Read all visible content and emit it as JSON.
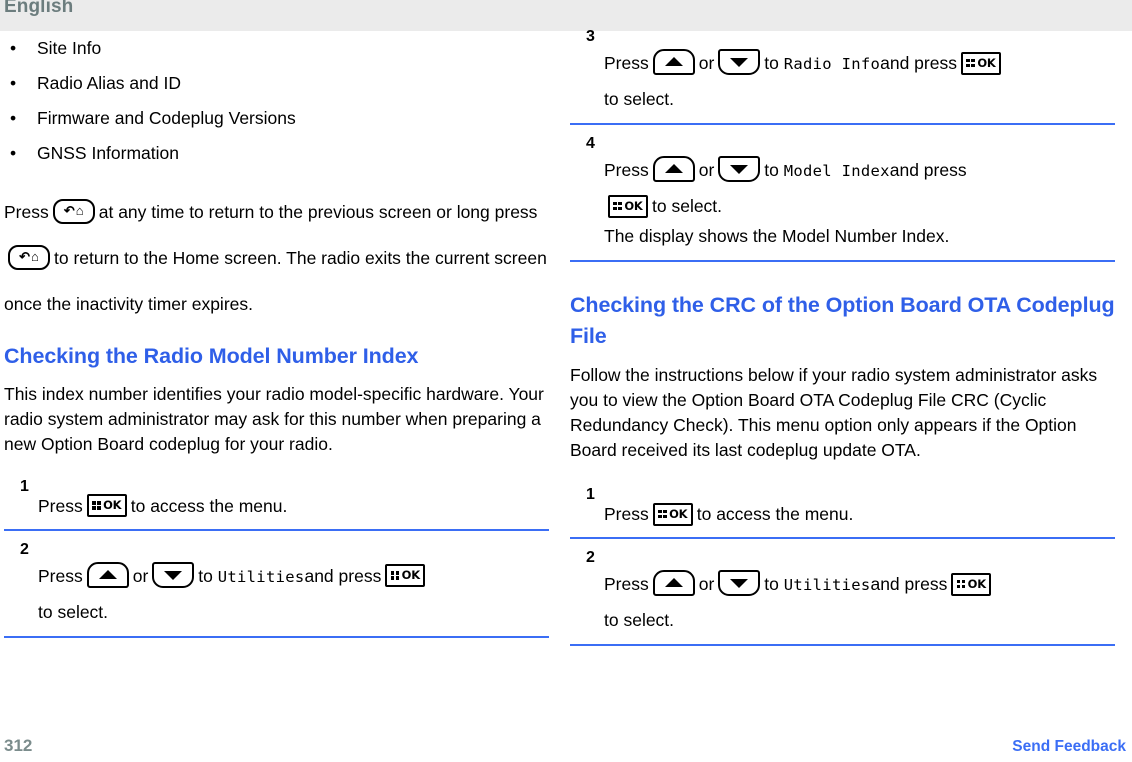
{
  "header": {
    "language": "English"
  },
  "footer": {
    "page_number": "312",
    "feedback_link": "Send Feedback"
  },
  "icons": {
    "ok_label": "OK",
    "ok_name": "ok-menu-key-icon",
    "up_name": "up-arrow-key-icon",
    "down_name": "down-arrow-key-icon",
    "back_name": "back-home-key-icon",
    "back_glyph_return": "↶",
    "back_glyph_home": "⌂"
  },
  "left_column": {
    "bullets": [
      {
        "marker": "•",
        "label": "Site Info"
      },
      {
        "marker": "•",
        "label": "Radio Alias and ID"
      },
      {
        "marker": "•",
        "label": "Firmware and Codeplug Versions"
      },
      {
        "marker": "•",
        "label": "GNSS Information"
      }
    ],
    "intro_paragraph": {
      "part1": "Press",
      "part2": "at any time to return to the previous screen or long press",
      "part3": "to return to the Home screen. The radio exits the current screen once the inactivity timer expires."
    },
    "heading": "Checking the Radio Model Number Index",
    "paragraph": "This index number identifies your radio model-specific hardware. Your radio system administrator may ask for this number when preparing a new Option Board codeplug for your radio.",
    "steps": [
      {
        "number": "1",
        "text_before": "Press",
        "text_after": "to access the menu."
      },
      {
        "number": "2",
        "text_before": "Press",
        "text_or": "or",
        "text_to": "to",
        "menu_item": "Utilities",
        "text_and_press": "and press",
        "text_after": "to select."
      }
    ]
  },
  "right_column": {
    "steps_top": [
      {
        "number": "3",
        "text_before": "Press",
        "text_or": "or",
        "text_to": "to",
        "menu_item": "Radio Info",
        "text_and_press": "and press",
        "text_after": "to select."
      },
      {
        "number": "4",
        "text_before": "Press",
        "text_or": "or",
        "text_to": "to",
        "menu_item": "Model Index",
        "text_and_press": "and press",
        "text_after": "to select.",
        "result_text": "The display shows the Model Number Index."
      }
    ],
    "heading": "Checking the CRC of the Option Board OTA Codeplug File",
    "paragraph": "Follow the instructions below if your radio system administrator asks you to view the Option Board OTA Codeplug File CRC (Cyclic Redundancy Check). This menu option only appears if the Option Board received its last codeplug update OTA.",
    "steps_bottom": [
      {
        "number": "1",
        "text_before": "Press",
        "text_after": "to access the menu."
      },
      {
        "number": "2",
        "text_before": "Press",
        "text_or": "or",
        "text_to": "to",
        "menu_item": "Utilities",
        "text_and_press": "and press",
        "text_after": "to select."
      }
    ]
  },
  "colors": {
    "heading_blue": "#2f5fe8",
    "divider_blue": "#3b6ef5",
    "header_band": "#ebebeb",
    "header_text": "#6c7d7e",
    "footer_gray": "#7b8c8c"
  }
}
